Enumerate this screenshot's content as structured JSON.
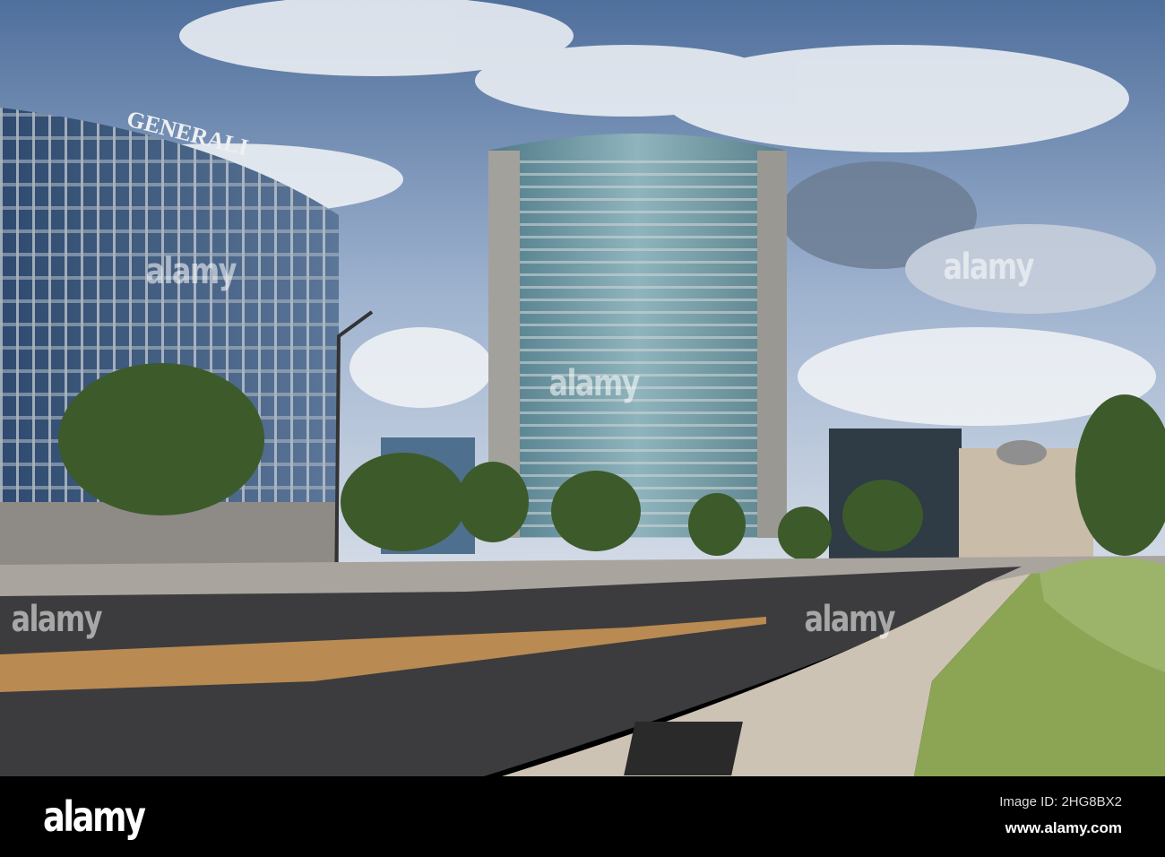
{
  "photo": {
    "building_sign": "GENERALI",
    "colors": {
      "sky": "#6f8fb8",
      "tower": "#6f9aa6",
      "road": "#3c3c3e",
      "curb": "#b98a52",
      "grass": "#8ba555"
    }
  },
  "watermark": {
    "text": "alamy"
  },
  "footer": {
    "logo": "alamy",
    "image_id": "Image ID: 2HG8BX2",
    "url": "www.alamy.com"
  }
}
